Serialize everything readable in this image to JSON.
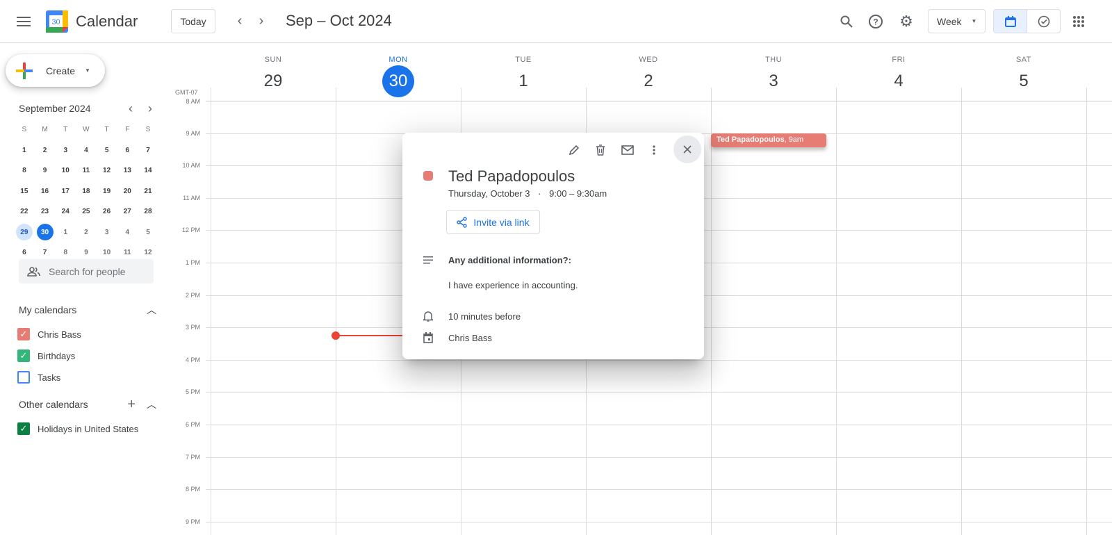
{
  "header": {
    "app_name": "Calendar",
    "logo_day": "30",
    "today_label": "Today",
    "range_title": "Sep – Oct 2024",
    "view_select": "Week"
  },
  "sidebar": {
    "create_label": "Create",
    "mini_cal": {
      "title": "September 2024",
      "dow": [
        "S",
        "M",
        "T",
        "W",
        "T",
        "F",
        "S"
      ],
      "weeks": [
        [
          "1",
          "2",
          "3",
          "4",
          "5",
          "6",
          "7"
        ],
        [
          "8",
          "9",
          "10",
          "11",
          "12",
          "13",
          "14"
        ],
        [
          "15",
          "16",
          "17",
          "18",
          "19",
          "20",
          "21"
        ],
        [
          "22",
          "23",
          "24",
          "25",
          "26",
          "27",
          "28"
        ],
        [
          "29",
          "30",
          "1",
          "2",
          "3",
          "4",
          "5"
        ],
        [
          "6",
          "7",
          "8",
          "9",
          "10",
          "11",
          "12"
        ]
      ]
    },
    "search_people_placeholder": "Search for people",
    "my_calendars_title": "My calendars",
    "my_calendars": [
      {
        "label": "Chris Bass",
        "color": "#e67c73",
        "checked": true
      },
      {
        "label": "Birthdays",
        "color": "#33b679",
        "checked": true
      },
      {
        "label": "Tasks",
        "color": "#4285f4",
        "checked": false
      }
    ],
    "other_calendars_title": "Other calendars",
    "other_calendars": [
      {
        "label": "Holidays in United States",
        "color": "#0b8043",
        "checked": true
      }
    ]
  },
  "week": {
    "timezone": "GMT-07",
    "days": [
      {
        "dow": "SUN",
        "num": "29"
      },
      {
        "dow": "MON",
        "num": "30",
        "today": true
      },
      {
        "dow": "TUE",
        "num": "1"
      },
      {
        "dow": "WED",
        "num": "2"
      },
      {
        "dow": "THU",
        "num": "3"
      },
      {
        "dow": "FRI",
        "num": "4"
      },
      {
        "dow": "SAT",
        "num": "5"
      }
    ],
    "hours": [
      "8 AM",
      "9 AM",
      "10 AM",
      "11 AM",
      "12 PM",
      "1 PM",
      "2 PM",
      "3 PM",
      "4 PM",
      "5 PM",
      "6 PM",
      "7 PM",
      "8 PM",
      "9 PM"
    ]
  },
  "event_chip": {
    "title": "Ted Papadopoulos",
    "time": ", 9am",
    "color": "#e67c73"
  },
  "popup": {
    "title": "Ted Papadopoulos",
    "date": "Thursday, October 3",
    "sep": "·",
    "time": "9:00 – 9:30am",
    "invite_label": "Invite via link",
    "desc_heading": "Any additional information?:",
    "desc_body": "I have experience in accounting.",
    "reminder": "10 minutes before",
    "calendar": "Chris Bass"
  }
}
